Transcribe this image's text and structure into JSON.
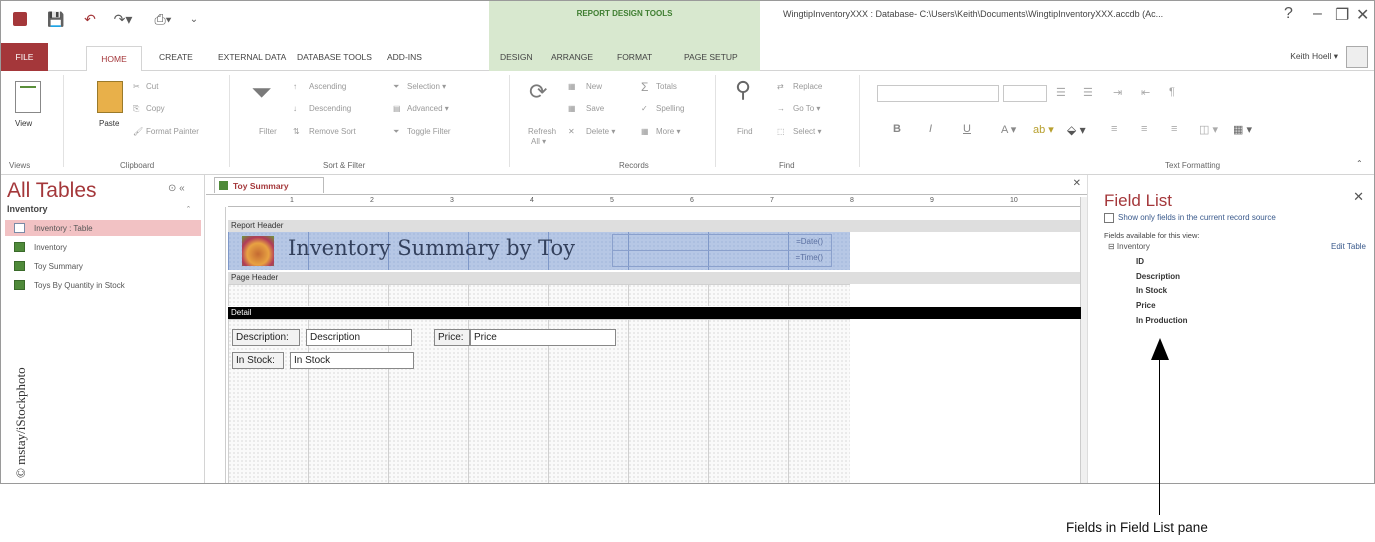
{
  "titlebar": {
    "context_label": "REPORT DESIGN TOOLS",
    "window_title": "WingtipInventoryXXX : Database- C:\\Users\\Keith\\Documents\\WingtipInventoryXXX.accdb (Ac...",
    "help": "?",
    "minimize": "–",
    "restore": "❐",
    "close": "✕"
  },
  "tabs": {
    "file": "FILE",
    "home": "HOME",
    "create": "CREATE",
    "external": "EXTERNAL DATA",
    "dbtools": "DATABASE TOOLS",
    "addins": "ADD-INS",
    "design": "DESIGN",
    "arrange": "ARRANGE",
    "format": "FORMAT",
    "pagesetup": "PAGE SETUP",
    "user": "Keith Hoell ▾"
  },
  "ribbon": {
    "view": "View",
    "paste": "Paste",
    "cut": "Cut",
    "copy": "Copy",
    "format_painter": "Format Painter",
    "filter": "Filter",
    "ascending": "Ascending",
    "descending": "Descending",
    "remove_sort": "Remove Sort",
    "selection": "Selection ▾",
    "advanced": "Advanced ▾",
    "toggle_filter": "Toggle Filter",
    "refresh": "Refresh",
    "refresh_all": "All ▾",
    "new": "New",
    "save": "Save",
    "delete": "Delete ▾",
    "totals": "Totals",
    "spelling": "Spelling",
    "more": "More ▾",
    "find": "Find",
    "replace": "Replace",
    "goto": "Go To ▾",
    "select": "Select ▾",
    "bold": "B",
    "italic": "I",
    "underline": "U",
    "groups": {
      "views": "Views",
      "clipboard": "Clipboard",
      "sort_filter": "Sort & Filter",
      "records": "Records",
      "find": "Find",
      "text_formatting": "Text Formatting"
    }
  },
  "nav": {
    "title": "All Tables",
    "group": "Inventory",
    "items": [
      "Inventory : Table",
      "Inventory",
      "Toy Summary",
      "Toys By Quantity in Stock"
    ]
  },
  "design": {
    "doc_tab": "Toy Summary",
    "ruler": [
      "1",
      "2",
      "3",
      "4",
      "5",
      "6",
      "7",
      "8",
      "9",
      "10"
    ],
    "report_header": "Report Header",
    "page_header": "Page Header",
    "detail": "Detail",
    "report_title": "Inventory Summary by Toy",
    "date_expr": "=Date()",
    "time_expr": "=Time()",
    "controls": {
      "desc_label": "Description:",
      "desc_field": "Description",
      "price_label": "Price:",
      "price_field": "Price",
      "stock_label": "In Stock:",
      "stock_field": "In Stock"
    }
  },
  "field_list": {
    "title": "Field List",
    "close": "✕",
    "show_only": "Show only fields in the current record source",
    "available": "Fields available for this view:",
    "table": "⊟ Inventory",
    "edit_table": "Edit Table",
    "fields": [
      "ID",
      "Description",
      "In Stock",
      "Price",
      "In Production"
    ]
  },
  "annotations": {
    "credit": "© mstay/iStockphoto",
    "callout": "Fields in Field List pane"
  }
}
